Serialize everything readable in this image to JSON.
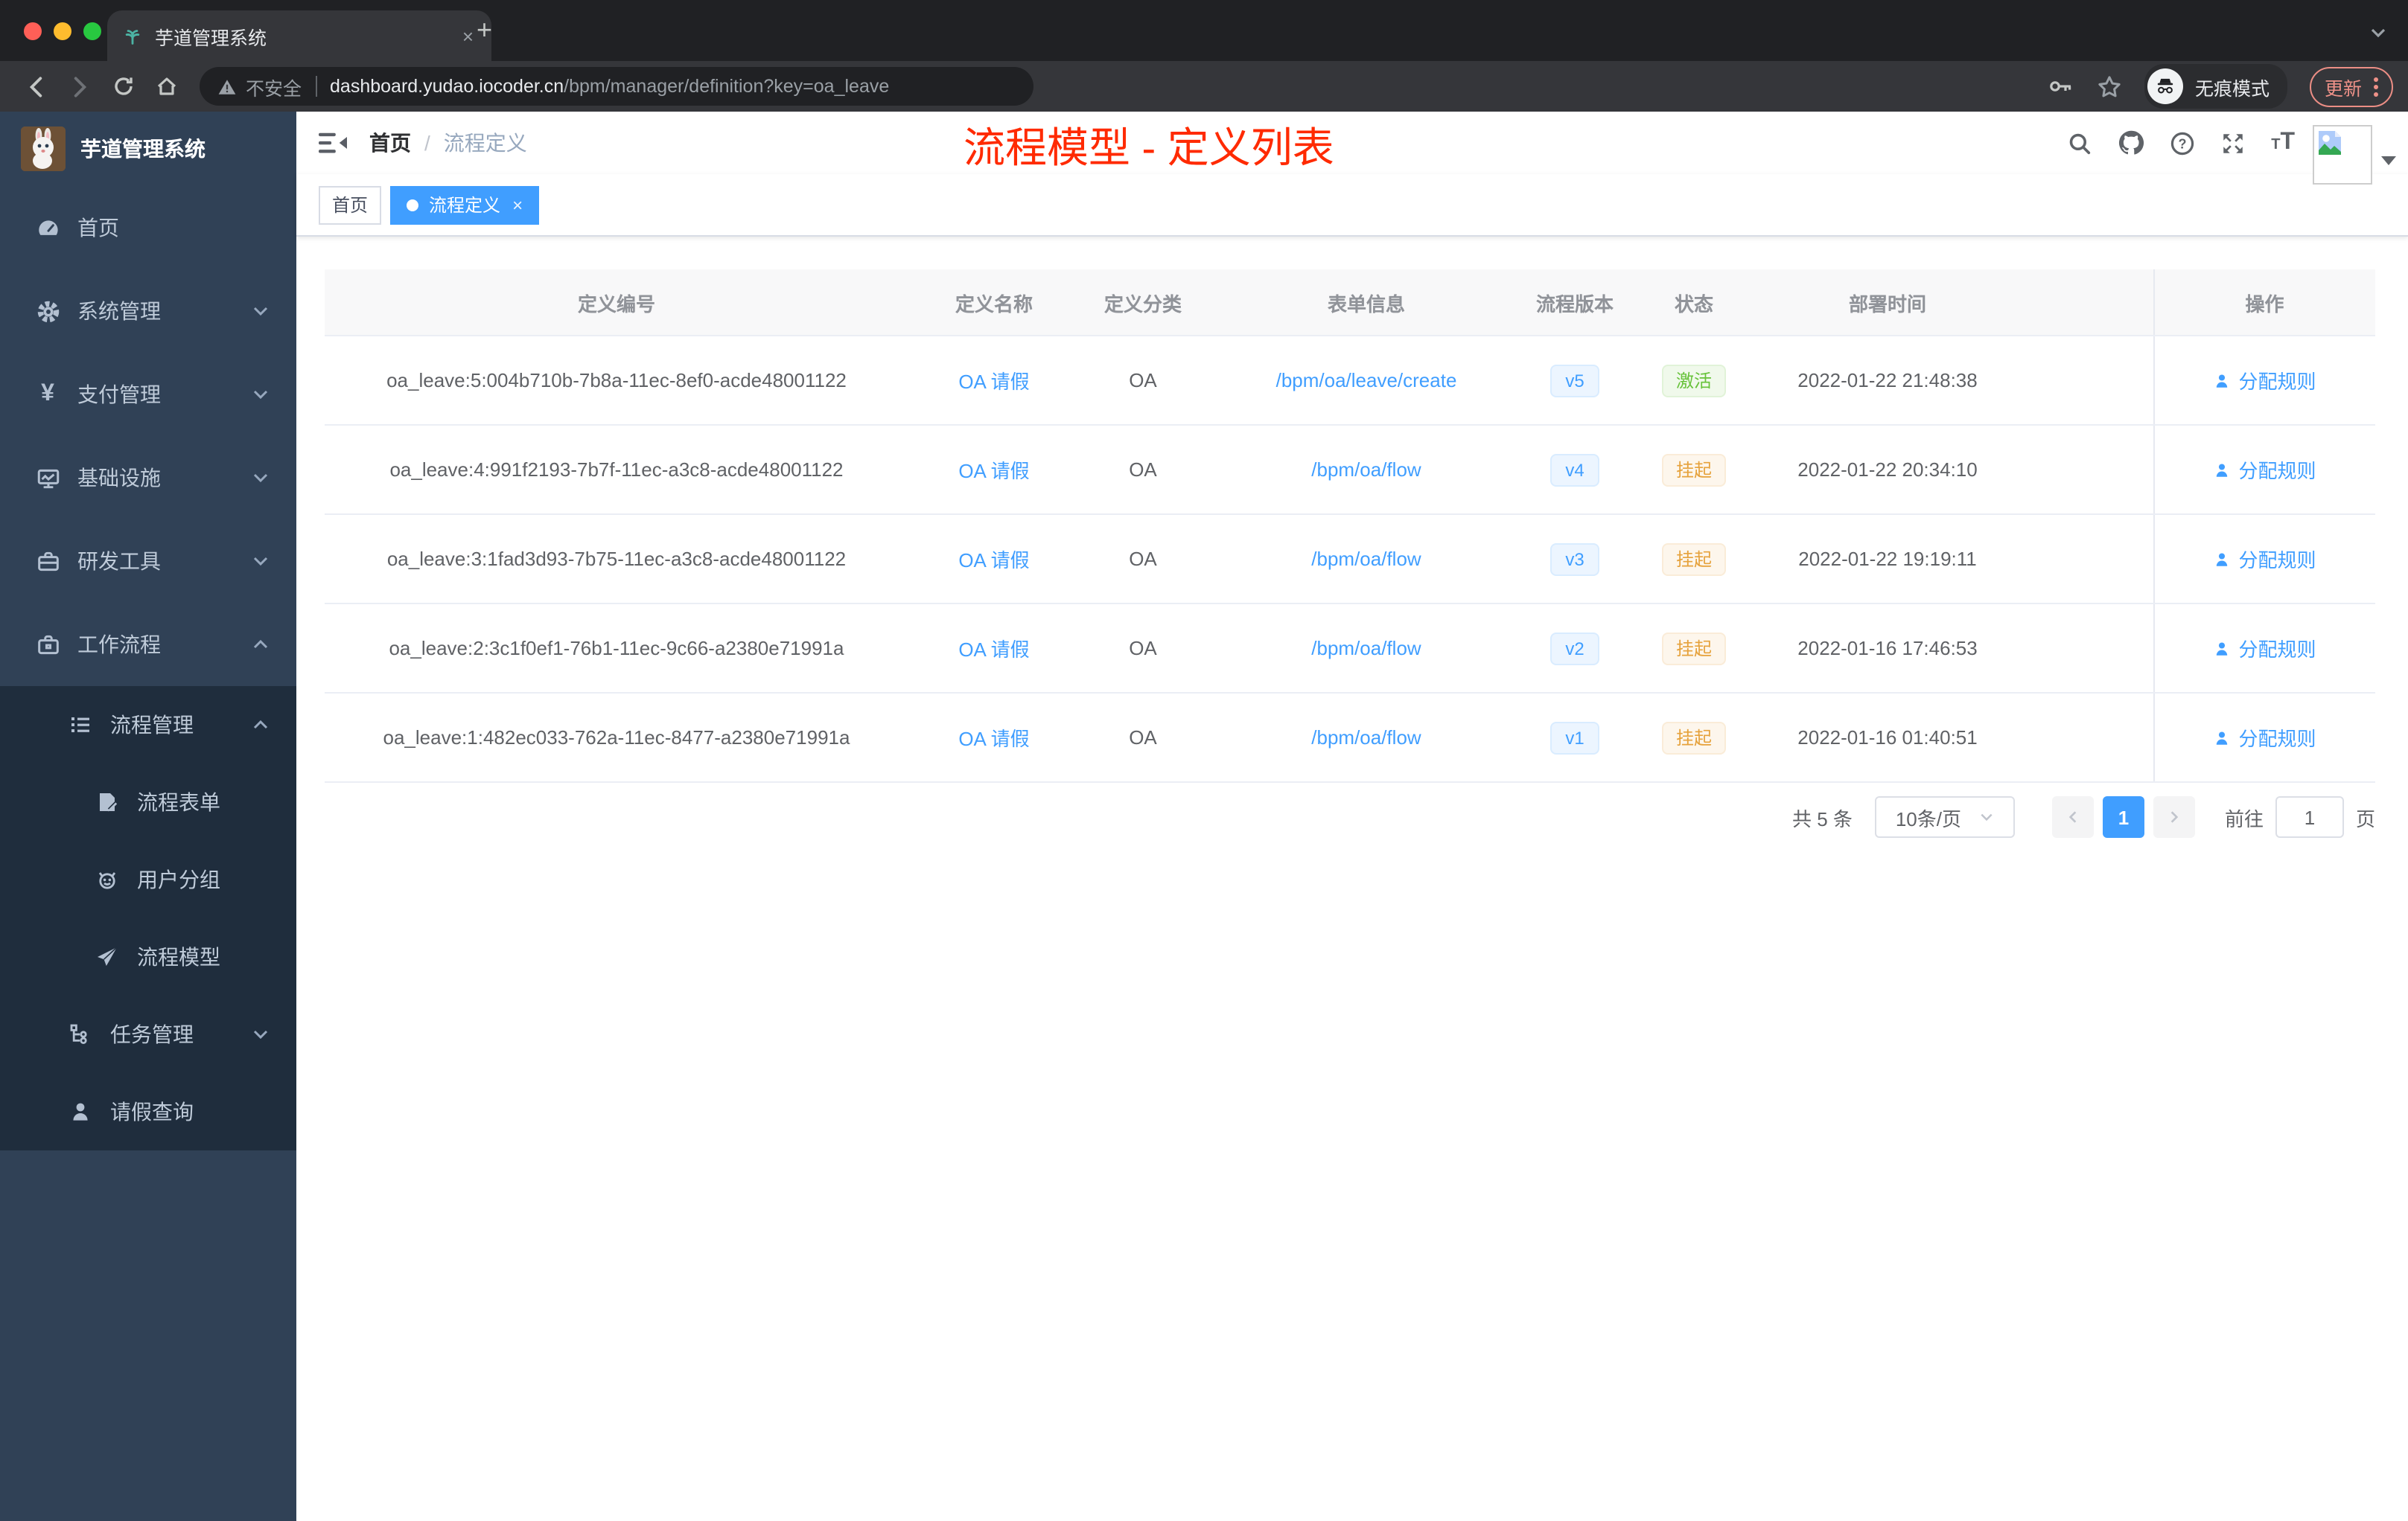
{
  "browser": {
    "tab_title": "芋道管理系统",
    "tab_close_glyph": "×",
    "new_tab_glyph": "+",
    "security_label": "不安全",
    "url_domain": "dashboard.yudao.iocoder.cn",
    "url_path": "/bpm/manager/definition?key=oa_leave",
    "incognito_label": "无痕模式",
    "update_label": "更新"
  },
  "sidebar": {
    "logo_title": "芋道管理系统",
    "menu": [
      {
        "label": "首页",
        "icon": "dashboard-icon"
      },
      {
        "label": "系统管理",
        "icon": "gear-icon",
        "chevron": "down"
      },
      {
        "label": "支付管理",
        "icon": "yen-icon",
        "chevron": "down"
      },
      {
        "label": "基础设施",
        "icon": "monitor-icon",
        "chevron": "down"
      },
      {
        "label": "研发工具",
        "icon": "toolbox-icon",
        "chevron": "down"
      },
      {
        "label": "工作流程",
        "icon": "briefcase-icon",
        "chevron": "up"
      }
    ],
    "submenu": [
      {
        "label": "流程管理",
        "icon": "list-icon",
        "chevron": "up"
      },
      {
        "label": "流程表单",
        "icon": "form-icon"
      },
      {
        "label": "用户分组",
        "icon": "group-icon"
      },
      {
        "label": "流程模型",
        "icon": "send-icon"
      },
      {
        "label": "任务管理",
        "icon": "tree-icon",
        "chevron": "down"
      },
      {
        "label": "请假查询",
        "icon": "user-icon"
      }
    ]
  },
  "navbar": {
    "breadcrumb_home": "首页",
    "breadcrumb_sep": "/",
    "breadcrumb_current": "流程定义",
    "annotation_title": "流程模型 - 定义列表",
    "annotation_color": "#ff2a00"
  },
  "tags": {
    "home": "首页",
    "active": "流程定义",
    "close_glyph": "×"
  },
  "table": {
    "columns": {
      "id": "定义编号",
      "name": "定义名称",
      "category": "定义分类",
      "form": "表单信息",
      "version": "流程版本",
      "status": "状态",
      "deploy": "部署时间",
      "action": "操作"
    },
    "rows": [
      {
        "id": "oa_leave:5:004b710b-7b8a-11ec-8ef0-acde48001122",
        "name": "OA 请假",
        "category": "OA",
        "form": "/bpm/oa/leave/create",
        "version": "v5",
        "status": "激活",
        "status_type": "success",
        "deploy": "2022-01-22 21:48:38",
        "action": "分配规则"
      },
      {
        "id": "oa_leave:4:991f2193-7b7f-11ec-a3c8-acde48001122",
        "name": "OA 请假",
        "category": "OA",
        "form": "/bpm/oa/flow",
        "version": "v4",
        "status": "挂起",
        "status_type": "warning",
        "deploy": "2022-01-22 20:34:10",
        "action": "分配规则"
      },
      {
        "id": "oa_leave:3:1fad3d93-7b75-11ec-a3c8-acde48001122",
        "name": "OA 请假",
        "category": "OA",
        "form": "/bpm/oa/flow",
        "version": "v3",
        "status": "挂起",
        "status_type": "warning",
        "deploy": "2022-01-22 19:19:11",
        "action": "分配规则"
      },
      {
        "id": "oa_leave:2:3c1f0ef1-76b1-11ec-9c66-a2380e71991a",
        "name": "OA 请假",
        "category": "OA",
        "form": "/bpm/oa/flow",
        "version": "v2",
        "status": "挂起",
        "status_type": "warning",
        "deploy": "2022-01-16 17:46:53",
        "action": "分配规则"
      },
      {
        "id": "oa_leave:1:482ec033-762a-11ec-8477-a2380e71991a",
        "name": "OA 请假",
        "category": "OA",
        "form": "/bpm/oa/flow",
        "version": "v1",
        "status": "挂起",
        "status_type": "warning",
        "deploy": "2022-01-16 01:40:51",
        "action": "分配规则"
      }
    ]
  },
  "pagination": {
    "total": "共 5 条",
    "page_size": "10条/页",
    "current_page": "1",
    "goto_label": "前往",
    "goto_value": "1",
    "unit_label": "页"
  },
  "colors": {
    "accent": "#409eff",
    "success": "#67c23a",
    "warning": "#e6a23c",
    "sidebar_bg": "#304156",
    "submenu_bg": "#1f2d3d",
    "annotation": "#ff2a00"
  }
}
